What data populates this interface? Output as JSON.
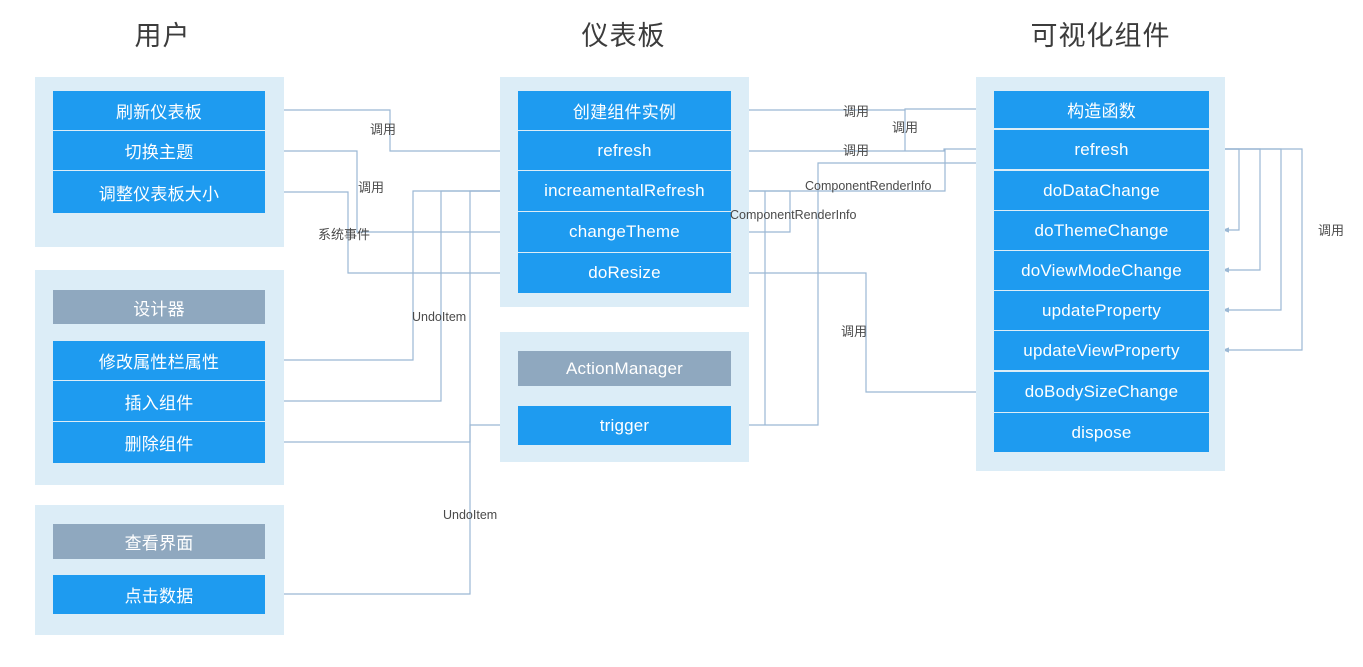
{
  "diagram": {
    "title": "Dashboard Component Interaction Flow",
    "background_color": "#ffffff",
    "node_blue": "#1e9bf0",
    "node_gray": "#8fa8bf",
    "group_bg": "#dcedf7",
    "wire_color": "#9bb8d4",
    "label_color": "#4a4a4a"
  },
  "columns": [
    {
      "id": "user",
      "title": "用户"
    },
    {
      "id": "dashboard",
      "title": "仪表板"
    },
    {
      "id": "component",
      "title": "可视化组件"
    }
  ],
  "groups": [
    {
      "id": "user-actions",
      "column": "user",
      "header": null,
      "nodes": [
        {
          "id": "refresh-dashboard",
          "label": "刷新仪表板",
          "style": "blue"
        },
        {
          "id": "switch-theme",
          "label": "切换主题",
          "style": "blue"
        },
        {
          "id": "resize-dashboard",
          "label": "调整仪表板大小",
          "style": "blue"
        }
      ]
    },
    {
      "id": "designer",
      "column": "user",
      "header": {
        "id": "designer-header",
        "label": "设计器",
        "style": "gray"
      },
      "nodes": [
        {
          "id": "modify-property",
          "label": "修改属性栏属性",
          "style": "blue"
        },
        {
          "id": "insert-component",
          "label": "插入组件",
          "style": "blue"
        },
        {
          "id": "delete-component",
          "label": "删除组件",
          "style": "blue"
        }
      ]
    },
    {
      "id": "view-ui",
      "column": "user",
      "header": {
        "id": "view-ui-header",
        "label": "查看界面",
        "style": "gray"
      },
      "nodes": [
        {
          "id": "click-data",
          "label": "点击数据",
          "style": "blue"
        }
      ]
    },
    {
      "id": "dashboard-methods",
      "column": "dashboard",
      "header": null,
      "nodes": [
        {
          "id": "create-instance",
          "label": "创建组件实例",
          "style": "blue"
        },
        {
          "id": "dash-refresh",
          "label": "refresh",
          "style": "blue"
        },
        {
          "id": "increamental-refresh",
          "label": "increamentalRefresh",
          "style": "blue"
        },
        {
          "id": "change-theme",
          "label": "changeTheme",
          "style": "blue"
        },
        {
          "id": "do-resize",
          "label": "doResize",
          "style": "blue"
        }
      ]
    },
    {
      "id": "action-manager",
      "column": "dashboard",
      "header": {
        "id": "action-manager-header",
        "label": "ActionManager",
        "style": "gray"
      },
      "nodes": [
        {
          "id": "trigger",
          "label": "trigger",
          "style": "blue"
        }
      ]
    },
    {
      "id": "component-methods",
      "column": "component",
      "header": null,
      "nodes": [
        {
          "id": "constructor",
          "label": "构造函数",
          "style": "blue"
        },
        {
          "id": "comp-refresh",
          "label": "refresh",
          "style": "blue"
        },
        {
          "id": "do-data-change",
          "label": "doDataChange",
          "style": "blue"
        },
        {
          "id": "do-theme-change",
          "label": "doThemeChange",
          "style": "blue"
        },
        {
          "id": "do-view-mode-change",
          "label": "doViewModeChange",
          "style": "blue"
        },
        {
          "id": "update-property",
          "label": "updateProperty",
          "style": "blue"
        },
        {
          "id": "update-view-property",
          "label": "updateViewProperty",
          "style": "blue"
        },
        {
          "id": "do-body-size-change",
          "label": "doBodySizeChange",
          "style": "blue"
        },
        {
          "id": "dispose",
          "label": "dispose",
          "style": "blue"
        }
      ]
    }
  ],
  "edge_labels": [
    {
      "id": "lbl-call-1",
      "text": "调用"
    },
    {
      "id": "lbl-call-2",
      "text": "调用"
    },
    {
      "id": "lbl-sysevent",
      "text": "系统事件"
    },
    {
      "id": "lbl-undo-1",
      "text": "UndoItem"
    },
    {
      "id": "lbl-undo-2",
      "text": "UndoItem"
    },
    {
      "id": "lbl-call-3",
      "text": "调用"
    },
    {
      "id": "lbl-call-4",
      "text": "调用"
    },
    {
      "id": "lbl-call-5",
      "text": "调用"
    },
    {
      "id": "lbl-cri-1",
      "text": "ComponentRenderInfo"
    },
    {
      "id": "lbl-cri-2",
      "text": "ComponentRenderInfo"
    },
    {
      "id": "lbl-call-6",
      "text": "调用"
    },
    {
      "id": "lbl-call-7",
      "text": "调用"
    }
  ]
}
